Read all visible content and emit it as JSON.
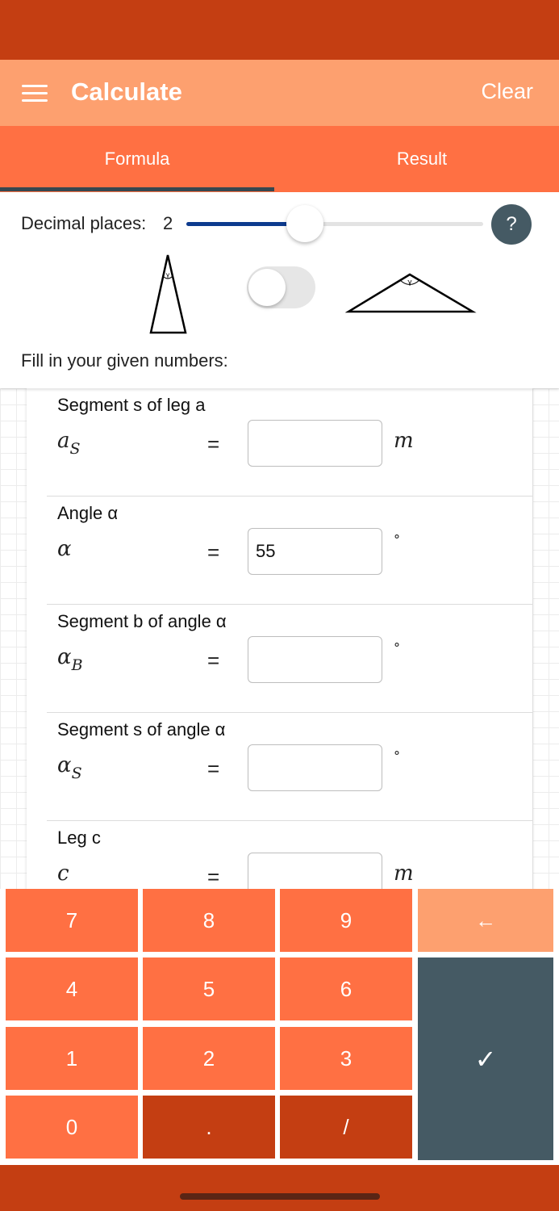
{
  "app": {
    "title": "Calculate",
    "clear_label": "Clear"
  },
  "tabs": [
    {
      "label": "Formula",
      "active": true
    },
    {
      "label": "Result",
      "active": false
    }
  ],
  "settings": {
    "decimal_label": "Decimal places:",
    "decimal_value": "2",
    "decimal_level": 0.4,
    "help_label": "?",
    "triangle_toggle_on": false,
    "fill_label": "Fill in your given numbers:"
  },
  "fields": [
    {
      "name": "Segment s of leg a",
      "symbol": "a",
      "symbol_sub": "S",
      "eq": "=",
      "value": "",
      "unit": "m"
    },
    {
      "name": "Angle α",
      "symbol": "α",
      "symbol_sub": "",
      "eq": "=",
      "value": "55",
      "unit": "°"
    },
    {
      "name": "Segment b of angle α",
      "symbol": "α",
      "symbol_sub": "B",
      "eq": "=",
      "value": "",
      "unit": "°"
    },
    {
      "name": "Segment s of angle α",
      "symbol": "α",
      "symbol_sub": "S",
      "eq": "=",
      "value": "",
      "unit": "°"
    },
    {
      "name": "Leg c",
      "symbol": "c",
      "symbol_sub": "",
      "eq": "=",
      "value": "",
      "unit": "m"
    }
  ],
  "keypad": {
    "k7": "7",
    "k8": "8",
    "k9": "9",
    "k4": "4",
    "k5": "5",
    "k6": "6",
    "k1": "1",
    "k2": "2",
    "k3": "3",
    "k0": "0",
    "dot": ".",
    "slash": "/",
    "backspace": "←",
    "confirm": "✓"
  },
  "colors": {
    "status_bar": "#c43e12",
    "app_bar": "#fda06f",
    "tab_bar": "#ff7043",
    "tab_indicator": "#37474f",
    "slider_accent": "#0d3b8e",
    "confirm_key": "#455a64"
  }
}
